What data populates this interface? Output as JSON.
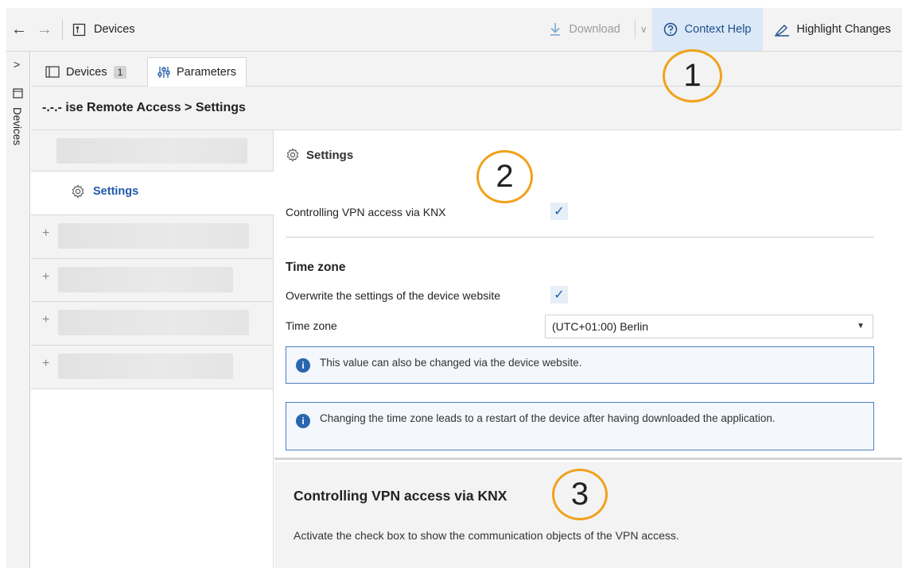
{
  "toolbar": {
    "back_arrow": "←",
    "forward_arrow": "→",
    "title": "Devices",
    "download_label": "Download",
    "context_help_label": "Context Help",
    "highlight_changes_label": "Highlight Changes"
  },
  "rail": {
    "expand_arrow": ">",
    "label": "Devices"
  },
  "tabs": {
    "devices": {
      "label": "Devices",
      "count": "1"
    },
    "parameters": {
      "label": "Parameters"
    }
  },
  "breadcrumb": "-.-.- ise Remote Access > Settings",
  "tree": {
    "selected_label": "Settings",
    "plus": "+"
  },
  "main": {
    "section_title": "Settings",
    "vpn_label": "Controlling VPN access via KNX",
    "check": "✓",
    "time_zone_group": "Time zone",
    "overwrite_label": "Overwrite the settings of the device website",
    "time_zone_label": "Time zone",
    "time_zone_value": "(UTC+01:00) Berlin",
    "info1": "This value can also be changed via the device website.",
    "info2": "Changing the time zone leads to a restart of the device after having downloaded the application.",
    "info_glyph": "i"
  },
  "help": {
    "title": "Controlling VPN access via KNX",
    "text": "Activate the check box to show the communication objects of the VPN access."
  },
  "annotations": [
    "1",
    "2",
    "3"
  ],
  "colors": {
    "accent": "#1f5aa6",
    "annotation": "#f0a21b",
    "active_toolbar": "#dbe8f7"
  }
}
